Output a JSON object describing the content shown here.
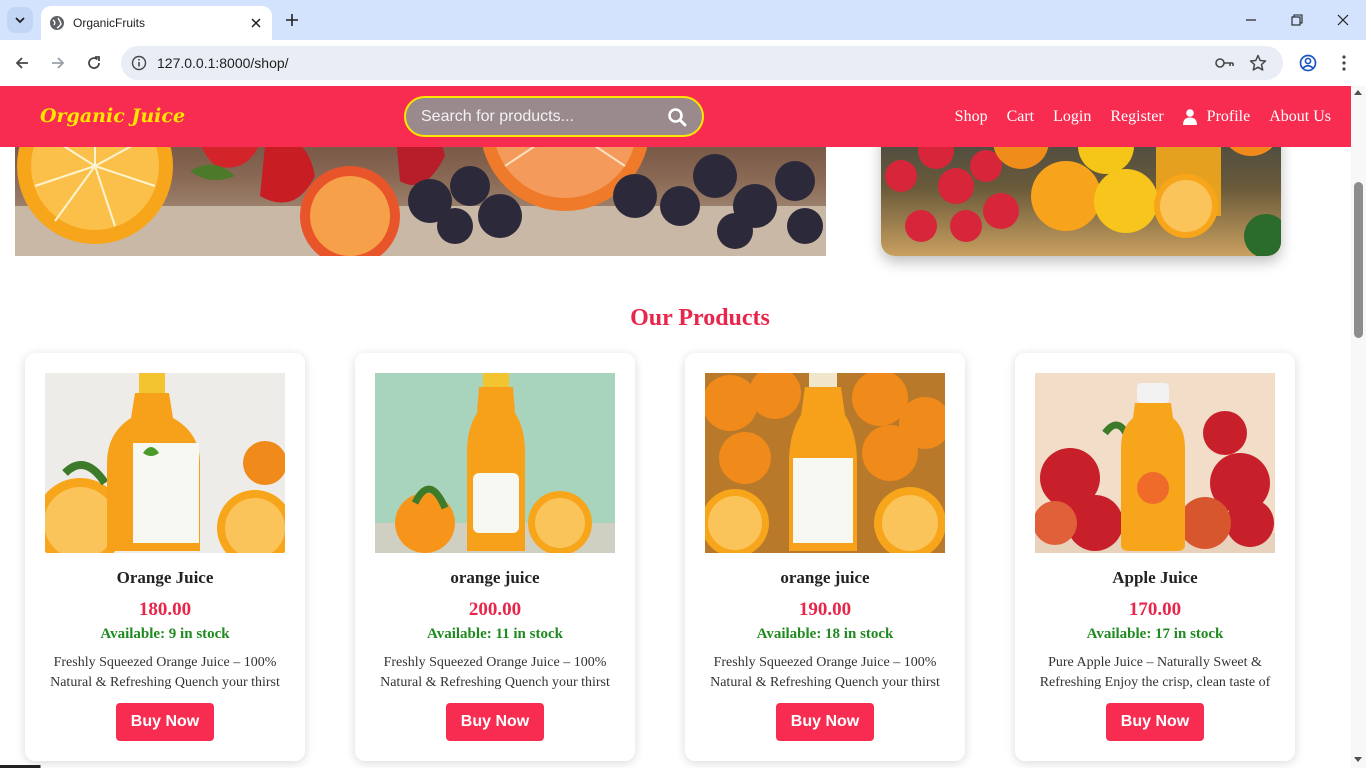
{
  "browser": {
    "tab_title": "OrganicFruits",
    "url": "127.0.0.1:8000/shop/"
  },
  "site": {
    "brand": "Organic Juice",
    "search": {
      "placeholder": "Search for products..."
    },
    "nav": [
      {
        "label": "Shop"
      },
      {
        "label": "Cart"
      },
      {
        "label": "Login"
      },
      {
        "label": "Register"
      },
      {
        "label": "Profile"
      },
      {
        "label": "About Us"
      }
    ],
    "accent_color": "#f72c50",
    "brand_color": "#ffe600"
  },
  "section_title": "Our Products",
  "products": [
    {
      "name": "Orange Juice",
      "price": "180.00",
      "stock": "Available: 9 in stock",
      "description": "Freshly Squeezed Orange Juice – 100% Natural & Refreshing Quench your thirst",
      "button": "Buy Now",
      "image": "orange-juice-bottle-image"
    },
    {
      "name": "orange juice",
      "price": "200.00",
      "stock": "Available: 11 in stock",
      "description": "Freshly Squeezed Orange Juice – 100% Natural & Refreshing Quench your thirst",
      "button": "Buy Now",
      "image": "orange-juice-bottle-image"
    },
    {
      "name": "orange juice",
      "price": "190.00",
      "stock": "Available: 18 in stock",
      "description": "Freshly Squeezed Orange Juice – 100% Natural & Refreshing Quench your thirst",
      "button": "Buy Now",
      "image": "orange-juice-bottle-image"
    },
    {
      "name": "Apple Juice",
      "price": "170.00",
      "stock": "Available: 17 in stock",
      "description": "Pure Apple Juice – Naturally Sweet & Refreshing Enjoy the crisp, clean taste of",
      "button": "Buy Now",
      "image": "apple-juice-bottle-image"
    }
  ]
}
